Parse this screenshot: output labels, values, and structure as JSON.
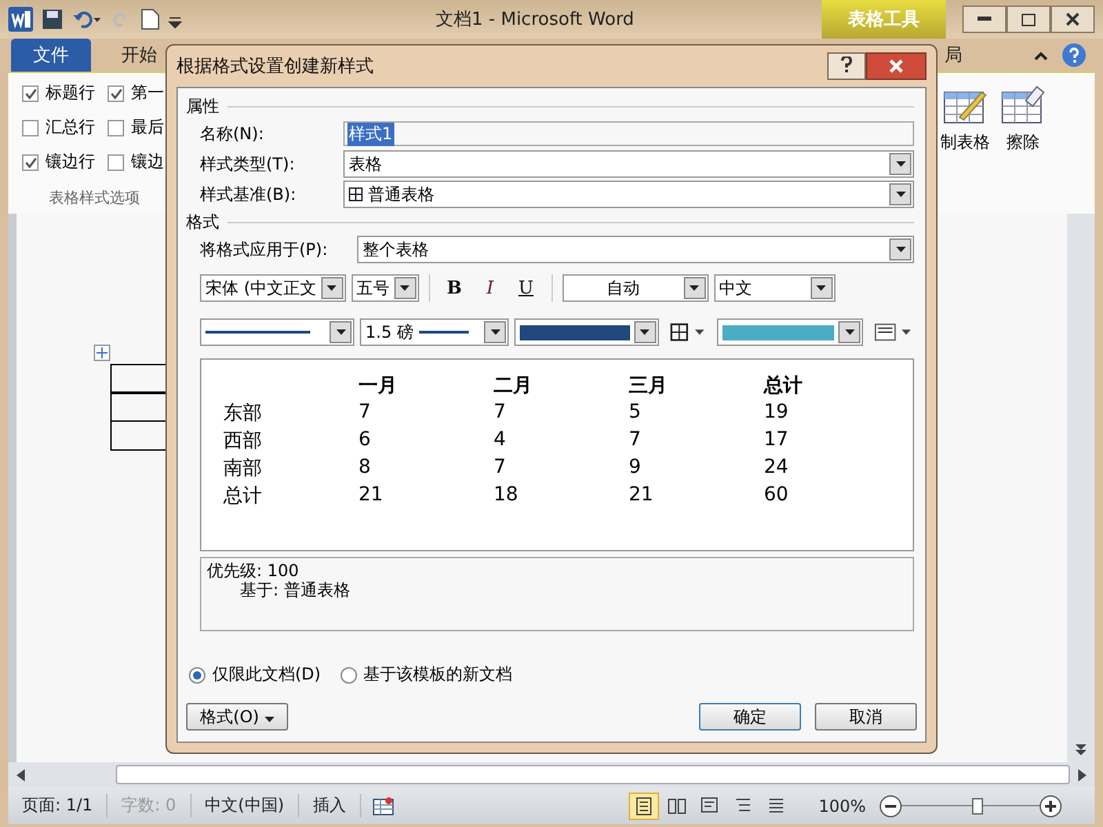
{
  "window": {
    "title": "文档1 - Microsoft Word",
    "context_tab": "表格工具"
  },
  "ribbon_tabs": [
    {
      "label": "文件",
      "kind": "file"
    },
    {
      "label": "开始",
      "kind": "tab"
    },
    {
      "label": "局",
      "kind": "tab"
    }
  ],
  "ribbon": {
    "checkboxes": [
      {
        "label": "标题行",
        "checked": true
      },
      {
        "label": "第一",
        "checked": true
      },
      {
        "label": "汇总行",
        "checked": false
      },
      {
        "label": "最后",
        "checked": false
      },
      {
        "label": "镶边行",
        "checked": true
      },
      {
        "label": "镶边",
        "checked": false
      }
    ],
    "group_label": "表格样式选项",
    "buttons": [
      {
        "label": "制表格",
        "kind": "draw"
      },
      {
        "label": "擦除",
        "kind": "erase"
      }
    ]
  },
  "dialog": {
    "title": "根据格式设置创建新样式",
    "properties_header": "属性",
    "fields": [
      {
        "label": "名称(N):",
        "value": "样式1",
        "kind": "text"
      },
      {
        "label": "样式类型(T):",
        "value": "表格",
        "kind": "select"
      },
      {
        "label": "样式基准(B):",
        "value": "普通表格",
        "kind": "table-select"
      }
    ],
    "format_header": "格式",
    "apply_to": {
      "label": "将格式应用于(P):",
      "value": "整个表格"
    },
    "font": "宋体 (中文正文",
    "size": "五号",
    "styles": [
      {
        "label": "B",
        "kind": "bold"
      },
      {
        "label": "I",
        "kind": "italic"
      },
      {
        "label": "U",
        "kind": "underline"
      }
    ],
    "font_color": "自动",
    "script": "中文",
    "border_width": "1.5 磅",
    "preview": {
      "columns": [
        "一月",
        "二月",
        "三月",
        "总计"
      ],
      "rows": [
        {
          "label": "东部",
          "values": [
            "7",
            "7",
            "5",
            "19"
          ]
        },
        {
          "label": "西部",
          "values": [
            "6",
            "4",
            "7",
            "17"
          ]
        },
        {
          "label": "南部",
          "values": [
            "8",
            "7",
            "9",
            "24"
          ]
        },
        {
          "label": "总计",
          "values": [
            "21",
            "18",
            "21",
            "60"
          ]
        }
      ]
    },
    "description": [
      "优先级: 100",
      "基于: 普通表格"
    ],
    "radios": [
      {
        "label": "仅限此文档(D)",
        "selected": true
      },
      {
        "label": "基于该模板的新文档",
        "selected": false
      }
    ],
    "format_button": "格式(O)",
    "ok": "确定",
    "cancel": "取消"
  },
  "status_bar": {
    "items": [
      {
        "label": "页面: 1/1",
        "disabled": false
      },
      {
        "label": "字数: 0",
        "disabled": true
      },
      {
        "label": "中文(中国)",
        "disabled": false
      },
      {
        "label": "插入",
        "disabled": false
      }
    ],
    "views": [
      {
        "kind": "print",
        "selected": true
      },
      {
        "kind": "read",
        "selected": false
      },
      {
        "kind": "web",
        "selected": false
      },
      {
        "kind": "outline",
        "selected": false
      },
      {
        "kind": "draft",
        "selected": false
      }
    ],
    "zoom": "100%",
    "zoom_slider": {
      "level": 0.55
    }
  }
}
